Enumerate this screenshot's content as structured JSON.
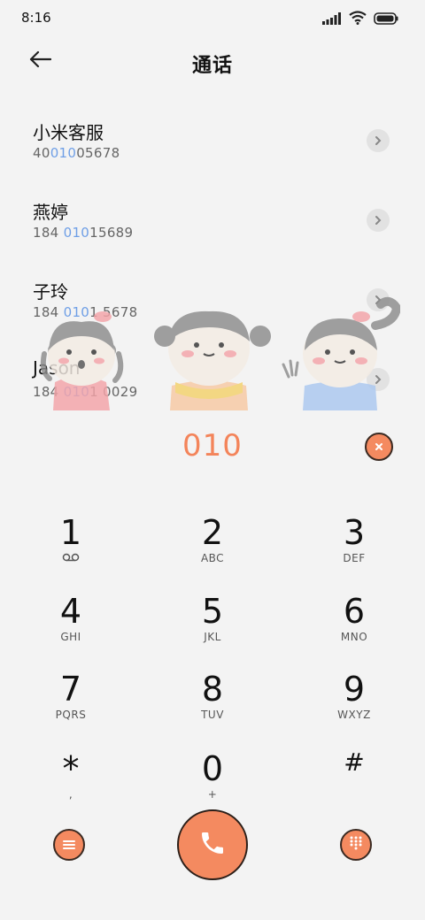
{
  "status_bar": {
    "time": "8:16",
    "icons": [
      "signal-icon",
      "wifi-icon",
      "battery-icon"
    ]
  },
  "header": {
    "back_icon": "back-arrow-icon",
    "title": "通话"
  },
  "contacts": [
    {
      "name": "小米客服",
      "number_parts": [
        "40",
        "010",
        "05678"
      ]
    },
    {
      "name": "燕婷",
      "number_parts": [
        "184 ",
        "010",
        "15689"
      ]
    },
    {
      "name": "子玲",
      "number_parts": [
        "184 ",
        "010",
        "1 5678"
      ]
    },
    {
      "name": "Jason",
      "number_parts": [
        "184 ",
        "010",
        "1 0029"
      ]
    }
  ],
  "dialer": {
    "input": "010",
    "clear_icon": "clear-icon"
  },
  "keypad": [
    {
      "digit": "1",
      "letters": "",
      "icon": "voicemail-icon"
    },
    {
      "digit": "2",
      "letters": "ABC"
    },
    {
      "digit": "3",
      "letters": "DEF"
    },
    {
      "digit": "4",
      "letters": "GHI"
    },
    {
      "digit": "5",
      "letters": "JKL"
    },
    {
      "digit": "6",
      "letters": "MNO"
    },
    {
      "digit": "7",
      "letters": "PQRS"
    },
    {
      "digit": "8",
      "letters": "TUV"
    },
    {
      "digit": "9",
      "letters": "WXYZ"
    },
    {
      "digit": "*",
      "letters": ","
    },
    {
      "digit": "0",
      "letters": "+"
    },
    {
      "digit": "#",
      "letters": ""
    }
  ],
  "actions": {
    "menu_icon": "menu-icon",
    "call_icon": "phone-icon",
    "keypad_icon": "dialpad-icon"
  },
  "colors": {
    "accent": "#f48a60",
    "highlight": "#6f9fe6",
    "background": "#f3f3f3"
  }
}
